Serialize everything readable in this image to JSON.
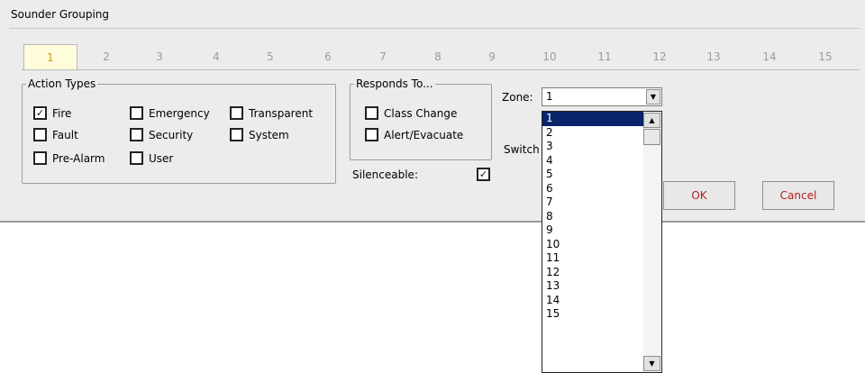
{
  "window": {
    "title": "Sounder Grouping"
  },
  "tabs": [
    "1",
    "2",
    "3",
    "4",
    "5",
    "6",
    "7",
    "8",
    "9",
    "10",
    "11",
    "12",
    "13",
    "14",
    "15"
  ],
  "action_types": {
    "legend": "Action Types",
    "items": [
      {
        "label": "Fire",
        "checked": true
      },
      {
        "label": "Fault",
        "checked": false
      },
      {
        "label": "Pre-Alarm",
        "checked": false
      },
      {
        "label": "Emergency",
        "checked": false
      },
      {
        "label": "Security",
        "checked": false
      },
      {
        "label": "User",
        "checked": false
      },
      {
        "label": "Transparent",
        "checked": false
      },
      {
        "label": "System",
        "checked": false
      }
    ]
  },
  "responds_to": {
    "legend": "Responds To...",
    "items": [
      {
        "label": "Class Change",
        "checked": false
      },
      {
        "label": "Alert/Evacuate",
        "checked": false
      }
    ]
  },
  "silenceable": {
    "label": "Silenceable:",
    "checked": true
  },
  "zone": {
    "label": "Zone:",
    "value": "1"
  },
  "switch_label": "Switch",
  "buttons": {
    "ok": "OK",
    "cancel": "Cancel"
  },
  "dropdown": {
    "selected": "1",
    "options": [
      "1",
      "2",
      "3",
      "4",
      "5",
      "6",
      "7",
      "8",
      "9",
      "10",
      "11",
      "12",
      "13",
      "14",
      "15"
    ]
  },
  "check_glyph": "✓",
  "icons": {
    "scroll_up": "▲",
    "scroll_down": "▼",
    "combo_arrow": "▼"
  },
  "colors": {
    "active_tab_bg": "#fffcdc",
    "active_tab_text": "#c8a000",
    "button_text": "#b22020",
    "selection": "#0a246a"
  }
}
